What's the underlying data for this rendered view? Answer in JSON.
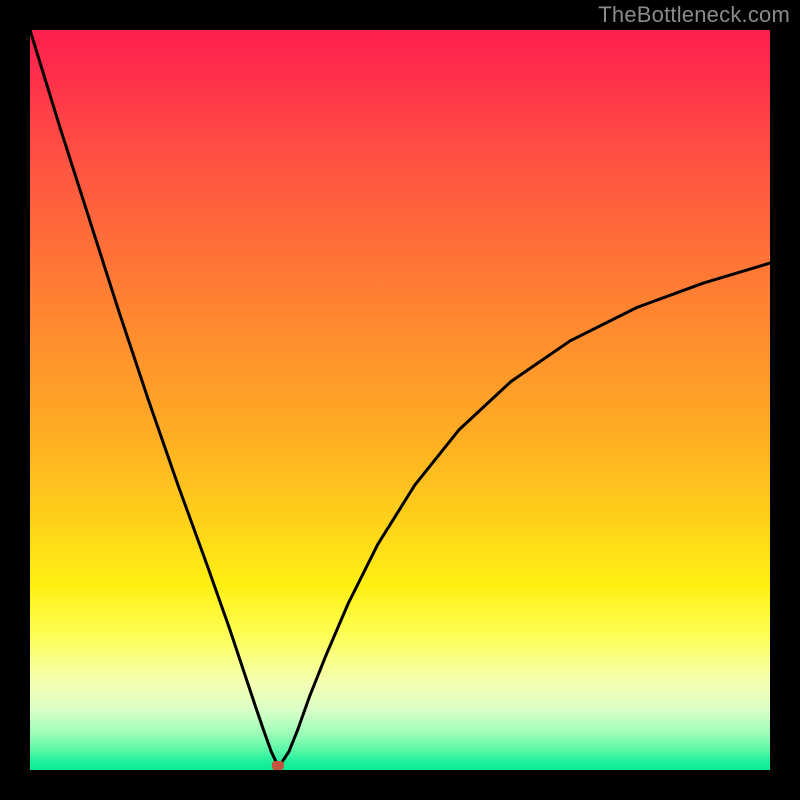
{
  "watermark": "TheBottleneck.com",
  "colors": {
    "page_bg": "#000000",
    "curve": "#000000",
    "marker": "#c1543e",
    "gradient_top": "#ff1f4e",
    "gradient_bottom": "#0cee99"
  },
  "chart_data": {
    "type": "line",
    "title": "",
    "xlabel": "",
    "ylabel": "",
    "xlim": [
      0,
      1
    ],
    "ylim": [
      0,
      1
    ],
    "axes_visible": false,
    "grid": false,
    "gradient_background": true,
    "marker": {
      "x": 0.335,
      "y": 0.006
    },
    "series": [
      {
        "name": "curve",
        "x": [
          0.0,
          0.04,
          0.08,
          0.12,
          0.16,
          0.2,
          0.24,
          0.27,
          0.29,
          0.305,
          0.317,
          0.326,
          0.333,
          0.34,
          0.35,
          0.362,
          0.378,
          0.4,
          0.43,
          0.47,
          0.52,
          0.58,
          0.65,
          0.73,
          0.82,
          0.91,
          1.0
        ],
        "y": [
          1.0,
          0.87,
          0.745,
          0.62,
          0.5,
          0.385,
          0.275,
          0.19,
          0.13,
          0.085,
          0.05,
          0.025,
          0.01,
          0.01,
          0.025,
          0.055,
          0.1,
          0.155,
          0.225,
          0.305,
          0.385,
          0.46,
          0.525,
          0.58,
          0.625,
          0.658,
          0.685
        ]
      }
    ]
  }
}
